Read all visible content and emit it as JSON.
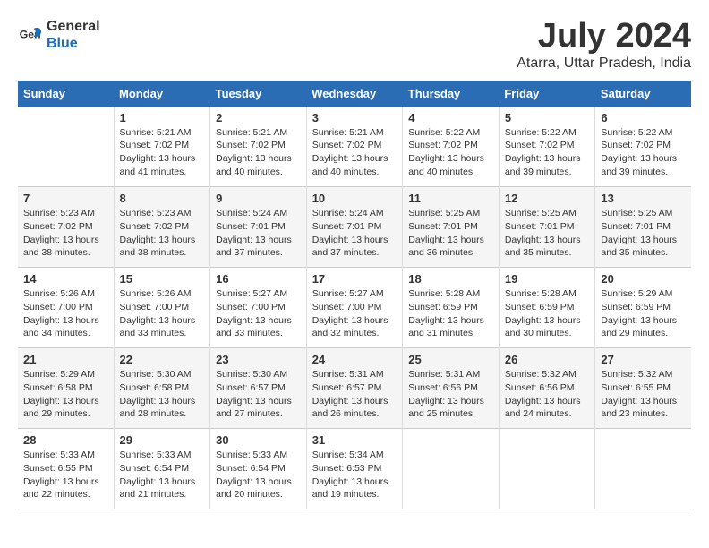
{
  "logo": {
    "line1": "General",
    "line2": "Blue"
  },
  "title": "July 2024",
  "subtitle": "Atarra, Uttar Pradesh, India",
  "days_header": [
    "Sunday",
    "Monday",
    "Tuesday",
    "Wednesday",
    "Thursday",
    "Friday",
    "Saturday"
  ],
  "weeks": [
    [
      {
        "day": "",
        "info": ""
      },
      {
        "day": "1",
        "info": "Sunrise: 5:21 AM\nSunset: 7:02 PM\nDaylight: 13 hours\nand 41 minutes."
      },
      {
        "day": "2",
        "info": "Sunrise: 5:21 AM\nSunset: 7:02 PM\nDaylight: 13 hours\nand 40 minutes."
      },
      {
        "day": "3",
        "info": "Sunrise: 5:21 AM\nSunset: 7:02 PM\nDaylight: 13 hours\nand 40 minutes."
      },
      {
        "day": "4",
        "info": "Sunrise: 5:22 AM\nSunset: 7:02 PM\nDaylight: 13 hours\nand 40 minutes."
      },
      {
        "day": "5",
        "info": "Sunrise: 5:22 AM\nSunset: 7:02 PM\nDaylight: 13 hours\nand 39 minutes."
      },
      {
        "day": "6",
        "info": "Sunrise: 5:22 AM\nSunset: 7:02 PM\nDaylight: 13 hours\nand 39 minutes."
      }
    ],
    [
      {
        "day": "7",
        "info": "Sunrise: 5:23 AM\nSunset: 7:02 PM\nDaylight: 13 hours\nand 38 minutes."
      },
      {
        "day": "8",
        "info": "Sunrise: 5:23 AM\nSunset: 7:02 PM\nDaylight: 13 hours\nand 38 minutes."
      },
      {
        "day": "9",
        "info": "Sunrise: 5:24 AM\nSunset: 7:01 PM\nDaylight: 13 hours\nand 37 minutes."
      },
      {
        "day": "10",
        "info": "Sunrise: 5:24 AM\nSunset: 7:01 PM\nDaylight: 13 hours\nand 37 minutes."
      },
      {
        "day": "11",
        "info": "Sunrise: 5:25 AM\nSunset: 7:01 PM\nDaylight: 13 hours\nand 36 minutes."
      },
      {
        "day": "12",
        "info": "Sunrise: 5:25 AM\nSunset: 7:01 PM\nDaylight: 13 hours\nand 35 minutes."
      },
      {
        "day": "13",
        "info": "Sunrise: 5:25 AM\nSunset: 7:01 PM\nDaylight: 13 hours\nand 35 minutes."
      }
    ],
    [
      {
        "day": "14",
        "info": "Sunrise: 5:26 AM\nSunset: 7:00 PM\nDaylight: 13 hours\nand 34 minutes."
      },
      {
        "day": "15",
        "info": "Sunrise: 5:26 AM\nSunset: 7:00 PM\nDaylight: 13 hours\nand 33 minutes."
      },
      {
        "day": "16",
        "info": "Sunrise: 5:27 AM\nSunset: 7:00 PM\nDaylight: 13 hours\nand 33 minutes."
      },
      {
        "day": "17",
        "info": "Sunrise: 5:27 AM\nSunset: 7:00 PM\nDaylight: 13 hours\nand 32 minutes."
      },
      {
        "day": "18",
        "info": "Sunrise: 5:28 AM\nSunset: 6:59 PM\nDaylight: 13 hours\nand 31 minutes."
      },
      {
        "day": "19",
        "info": "Sunrise: 5:28 AM\nSunset: 6:59 PM\nDaylight: 13 hours\nand 30 minutes."
      },
      {
        "day": "20",
        "info": "Sunrise: 5:29 AM\nSunset: 6:59 PM\nDaylight: 13 hours\nand 29 minutes."
      }
    ],
    [
      {
        "day": "21",
        "info": "Sunrise: 5:29 AM\nSunset: 6:58 PM\nDaylight: 13 hours\nand 29 minutes."
      },
      {
        "day": "22",
        "info": "Sunrise: 5:30 AM\nSunset: 6:58 PM\nDaylight: 13 hours\nand 28 minutes."
      },
      {
        "day": "23",
        "info": "Sunrise: 5:30 AM\nSunset: 6:57 PM\nDaylight: 13 hours\nand 27 minutes."
      },
      {
        "day": "24",
        "info": "Sunrise: 5:31 AM\nSunset: 6:57 PM\nDaylight: 13 hours\nand 26 minutes."
      },
      {
        "day": "25",
        "info": "Sunrise: 5:31 AM\nSunset: 6:56 PM\nDaylight: 13 hours\nand 25 minutes."
      },
      {
        "day": "26",
        "info": "Sunrise: 5:32 AM\nSunset: 6:56 PM\nDaylight: 13 hours\nand 24 minutes."
      },
      {
        "day": "27",
        "info": "Sunrise: 5:32 AM\nSunset: 6:55 PM\nDaylight: 13 hours\nand 23 minutes."
      }
    ],
    [
      {
        "day": "28",
        "info": "Sunrise: 5:33 AM\nSunset: 6:55 PM\nDaylight: 13 hours\nand 22 minutes."
      },
      {
        "day": "29",
        "info": "Sunrise: 5:33 AM\nSunset: 6:54 PM\nDaylight: 13 hours\nand 21 minutes."
      },
      {
        "day": "30",
        "info": "Sunrise: 5:33 AM\nSunset: 6:54 PM\nDaylight: 13 hours\nand 20 minutes."
      },
      {
        "day": "31",
        "info": "Sunrise: 5:34 AM\nSunset: 6:53 PM\nDaylight: 13 hours\nand 19 minutes."
      },
      {
        "day": "",
        "info": ""
      },
      {
        "day": "",
        "info": ""
      },
      {
        "day": "",
        "info": ""
      }
    ]
  ]
}
